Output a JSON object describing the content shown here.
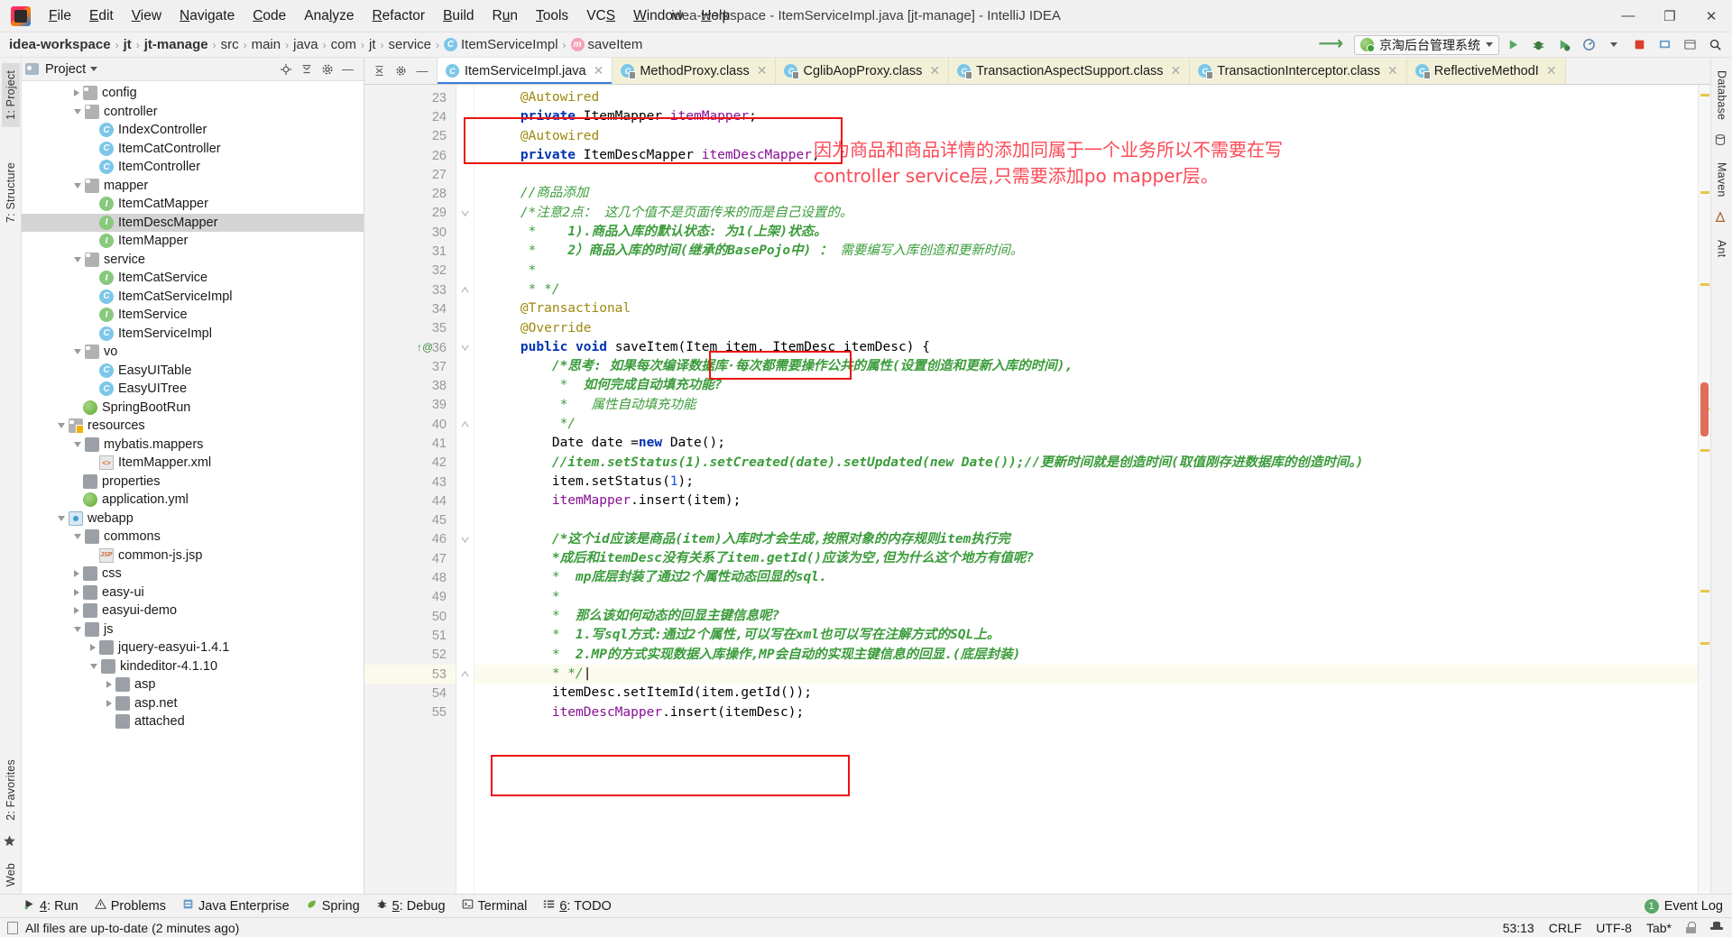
{
  "window": {
    "title": "idea-workspace - ItemServiceImpl.java [jt-manage] - IntelliJ IDEA",
    "minimize": "—",
    "maximize": "❐",
    "close": "✕"
  },
  "menubar": {
    "items": [
      "File",
      "Edit",
      "View",
      "Navigate",
      "Code",
      "Analyze",
      "Refactor",
      "Build",
      "Run",
      "Tools",
      "VCS",
      "Window",
      "Help"
    ]
  },
  "breadcrumb": {
    "items": [
      {
        "label": "idea-workspace",
        "icon": "",
        "strong": true
      },
      {
        "label": "jt",
        "icon": "",
        "strong": true
      },
      {
        "label": "jt-manage",
        "icon": "",
        "strong": true
      },
      {
        "label": "src",
        "icon": "",
        "strong": false
      },
      {
        "label": "main",
        "icon": "",
        "strong": false
      },
      {
        "label": "java",
        "icon": "",
        "strong": false
      },
      {
        "label": "com",
        "icon": "",
        "strong": false
      },
      {
        "label": "jt",
        "icon": "",
        "strong": false
      },
      {
        "label": "service",
        "icon": "",
        "strong": false
      },
      {
        "label": "ItemServiceImpl",
        "icon": "class-icon",
        "strong": false
      },
      {
        "label": "saveItem",
        "icon": "method-icon",
        "strong": false
      }
    ],
    "separator": "›"
  },
  "toolbar": {
    "run_configuration": "京淘后台管理系统",
    "icons": [
      "run-icon",
      "debug-icon",
      "run-with-coverage-icon",
      "profile-icon",
      "attach-icon",
      "stop-icon",
      "update-icon",
      "settings-icon",
      "search-icon"
    ]
  },
  "project_panel": {
    "title": "Project",
    "header_buttons": [
      "locate-icon",
      "collapse-all-icon",
      "settings-icon",
      "hide-icon"
    ],
    "tree": [
      {
        "indent": 3,
        "arrow": "closed",
        "icon": "folder",
        "label": "config",
        "selected": false
      },
      {
        "indent": 3,
        "arrow": "open",
        "icon": "folder",
        "label": "controller",
        "selected": false
      },
      {
        "indent": 4,
        "arrow": "none",
        "icon": "class",
        "label": "IndexController",
        "selected": false
      },
      {
        "indent": 4,
        "arrow": "none",
        "icon": "class",
        "label": "ItemCatController",
        "selected": false
      },
      {
        "indent": 4,
        "arrow": "none",
        "icon": "class",
        "label": "ItemController",
        "selected": false
      },
      {
        "indent": 3,
        "arrow": "open",
        "icon": "folder",
        "label": "mapper",
        "selected": false
      },
      {
        "indent": 4,
        "arrow": "none",
        "icon": "iface",
        "label": "ItemCatMapper",
        "selected": false
      },
      {
        "indent": 4,
        "arrow": "none",
        "icon": "iface",
        "label": "ItemDescMapper",
        "selected": true
      },
      {
        "indent": 4,
        "arrow": "none",
        "icon": "iface",
        "label": "ItemMapper",
        "selected": false
      },
      {
        "indent": 3,
        "arrow": "open",
        "icon": "folder",
        "label": "service",
        "selected": false
      },
      {
        "indent": 4,
        "arrow": "none",
        "icon": "iface",
        "label": "ItemCatService",
        "selected": false
      },
      {
        "indent": 4,
        "arrow": "none",
        "icon": "class",
        "label": "ItemCatServiceImpl",
        "selected": false
      },
      {
        "indent": 4,
        "arrow": "none",
        "icon": "iface",
        "label": "ItemService",
        "selected": false
      },
      {
        "indent": 4,
        "arrow": "none",
        "icon": "class",
        "label": "ItemServiceImpl",
        "selected": false
      },
      {
        "indent": 3,
        "arrow": "open",
        "icon": "folder",
        "label": "vo",
        "selected": false
      },
      {
        "indent": 4,
        "arrow": "none",
        "icon": "class",
        "label": "EasyUITable",
        "selected": false
      },
      {
        "indent": 4,
        "arrow": "none",
        "icon": "class",
        "label": "EasyUITree",
        "selected": false
      },
      {
        "indent": 3,
        "arrow": "none",
        "icon": "spring",
        "label": "SpringBootRun",
        "selected": false
      },
      {
        "indent": 2,
        "arrow": "open",
        "icon": "folder-res",
        "label": "resources",
        "selected": false
      },
      {
        "indent": 3,
        "arrow": "open",
        "icon": "folder-plain",
        "label": "mybatis.mappers",
        "selected": false
      },
      {
        "indent": 4,
        "arrow": "none",
        "icon": "xml",
        "label": "ItemMapper.xml",
        "selected": false
      },
      {
        "indent": 3,
        "arrow": "none",
        "icon": "folder-plain",
        "label": "properties",
        "selected": false
      },
      {
        "indent": 3,
        "arrow": "none",
        "icon": "spring",
        "label": "application.yml",
        "selected": false
      },
      {
        "indent": 2,
        "arrow": "open",
        "icon": "web",
        "label": "webapp",
        "selected": false
      },
      {
        "indent": 3,
        "arrow": "open",
        "icon": "folder-plain",
        "label": "commons",
        "selected": false
      },
      {
        "indent": 4,
        "arrow": "none",
        "icon": "jsp",
        "label": "common-js.jsp",
        "selected": false
      },
      {
        "indent": 3,
        "arrow": "closed",
        "icon": "folder-plain",
        "label": "css",
        "selected": false
      },
      {
        "indent": 3,
        "arrow": "closed",
        "icon": "folder-plain",
        "label": "easy-ui",
        "selected": false
      },
      {
        "indent": 3,
        "arrow": "closed",
        "icon": "folder-plain",
        "label": "easyui-demo",
        "selected": false
      },
      {
        "indent": 3,
        "arrow": "open",
        "icon": "folder-plain",
        "label": "js",
        "selected": false
      },
      {
        "indent": 4,
        "arrow": "closed",
        "icon": "folder-plain",
        "label": "jquery-easyui-1.4.1",
        "selected": false
      },
      {
        "indent": 4,
        "arrow": "open",
        "icon": "folder-plain",
        "label": "kindeditor-4.1.10",
        "selected": false
      },
      {
        "indent": 5,
        "arrow": "closed",
        "icon": "folder-plain",
        "label": "asp",
        "selected": false
      },
      {
        "indent": 5,
        "arrow": "closed",
        "icon": "folder-plain",
        "label": "asp.net",
        "selected": false
      },
      {
        "indent": 5,
        "arrow": "none",
        "icon": "folder-plain",
        "label": "attached",
        "selected": false
      }
    ]
  },
  "left_rail": {
    "tabs": [
      "1: Project",
      "7: Structure",
      "2: Favorites",
      "Web"
    ]
  },
  "right_rail": {
    "tabs": [
      "Database",
      "Maven",
      "Ant"
    ]
  },
  "tabs": [
    {
      "label": "ItemServiceImpl.java",
      "icon": "java-class-icon",
      "active": true,
      "locked": false
    },
    {
      "label": "MethodProxy.class",
      "icon": "class-file-icon",
      "active": false,
      "locked": true
    },
    {
      "label": "CglibAopProxy.class",
      "icon": "class-file-icon",
      "active": false,
      "locked": true
    },
    {
      "label": "TransactionAspectSupport.class",
      "icon": "class-file-icon",
      "active": false,
      "locked": true
    },
    {
      "label": "TransactionInterceptor.class",
      "icon": "class-file-icon",
      "active": false,
      "locked": true
    },
    {
      "label": "ReflectiveMethodI",
      "icon": "class-file-icon",
      "active": false,
      "locked": true
    }
  ],
  "editor": {
    "first_line_number": 23,
    "current_line": 53,
    "lines": [
      {
        "n": 23,
        "fold": "",
        "marks": "",
        "tokens": [
          {
            "t": "    ",
            "c": "pun"
          },
          {
            "t": "@Autowired",
            "c": "ann"
          }
        ]
      },
      {
        "n": 24,
        "fold": "",
        "marks": "",
        "tokens": [
          {
            "t": "    ",
            "c": "pun"
          },
          {
            "t": "private ",
            "c": "kw"
          },
          {
            "t": "ItemMapper ",
            "c": "typ"
          },
          {
            "t": "itemMapper",
            "c": "fld"
          },
          {
            "t": ";",
            "c": "pun"
          }
        ]
      },
      {
        "n": 25,
        "fold": "",
        "marks": "",
        "tokens": [
          {
            "t": "    ",
            "c": "pun"
          },
          {
            "t": "@Autowired",
            "c": "ann"
          }
        ]
      },
      {
        "n": 26,
        "fold": "",
        "marks": "",
        "tokens": [
          {
            "t": "    ",
            "c": "pun"
          },
          {
            "t": "private ",
            "c": "kw"
          },
          {
            "t": "ItemDescMapper ",
            "c": "typ"
          },
          {
            "t": "itemDescMapper",
            "c": "fld"
          },
          {
            "t": ";",
            "c": "pun"
          }
        ]
      },
      {
        "n": 27,
        "fold": "",
        "marks": "",
        "tokens": []
      },
      {
        "n": 28,
        "fold": "",
        "marks": "",
        "tokens": [
          {
            "t": "    ",
            "c": "pun"
          },
          {
            "t": "//商品添加",
            "c": "cmtg"
          }
        ]
      },
      {
        "n": 29,
        "fold": "minus",
        "marks": "",
        "tokens": [
          {
            "t": "    ",
            "c": "pun"
          },
          {
            "t": "/*注意2点： 这几个值不是页面传来的而是自己设置的。",
            "c": "cmtg"
          }
        ]
      },
      {
        "n": 30,
        "fold": "",
        "marks": "",
        "tokens": [
          {
            "t": "     *    ",
            "c": "cmtg"
          },
          {
            "t": "1).商品入库的默认状态: 为1(上架)状态。",
            "c": "cmtgb"
          }
        ]
      },
      {
        "n": 31,
        "fold": "",
        "marks": "",
        "tokens": [
          {
            "t": "     *    ",
            "c": "cmtg"
          },
          {
            "t": "2）商品入库的时间(继承的BasePojo中) ： ",
            "c": "cmtgb"
          },
          {
            "t": "需要编写入库创造和更新时间。",
            "c": "cmtg"
          }
        ]
      },
      {
        "n": 32,
        "fold": "",
        "marks": "",
        "tokens": [
          {
            "t": "     *",
            "c": "cmtg"
          }
        ]
      },
      {
        "n": 33,
        "fold": "plus",
        "marks": "",
        "tokens": [
          {
            "t": "     * */",
            "c": "cmtg"
          }
        ]
      },
      {
        "n": 34,
        "fold": "",
        "marks": "",
        "tokens": [
          {
            "t": "    ",
            "c": "pun"
          },
          {
            "t": "@Transactional",
            "c": "ann"
          }
        ]
      },
      {
        "n": 35,
        "fold": "",
        "marks": "",
        "tokens": [
          {
            "t": "    ",
            "c": "pun"
          },
          {
            "t": "@Override",
            "c": "ann"
          }
        ]
      },
      {
        "n": 36,
        "fold": "minus",
        "marks": "impl",
        "tokens": [
          {
            "t": "    ",
            "c": "pun"
          },
          {
            "t": "public ",
            "c": "kw"
          },
          {
            "t": "void ",
            "c": "kw"
          },
          {
            "t": "saveItem",
            "c": "typ"
          },
          {
            "t": "(",
            "c": "pun"
          },
          {
            "t": "Item ",
            "c": "typ"
          },
          {
            "t": "item",
            "c": "pun"
          },
          {
            "t": ", ",
            "c": "pun"
          },
          {
            "t": "ItemDesc ",
            "c": "typ"
          },
          {
            "t": "itemDesc",
            "c": "pun"
          },
          {
            "t": ") {",
            "c": "pun"
          }
        ]
      },
      {
        "n": 37,
        "fold": "",
        "marks": "",
        "tokens": [
          {
            "t": "        ",
            "c": "pun"
          },
          {
            "t": "/*思考: 如果每次编译数据库·每次都需要操作公共的属性(设置创造和更新入库的时间),",
            "c": "cmtgb"
          }
        ]
      },
      {
        "n": 38,
        "fold": "",
        "marks": "",
        "tokens": [
          {
            "t": "         *  ",
            "c": "cmtg"
          },
          {
            "t": "如何完成自动填充功能?",
            "c": "cmtgb"
          }
        ]
      },
      {
        "n": 39,
        "fold": "",
        "marks": "",
        "tokens": [
          {
            "t": "         *   ",
            "c": "cmtg"
          },
          {
            "t": "属性自动填充功能",
            "c": "cmtg"
          }
        ]
      },
      {
        "n": 40,
        "fold": "plus",
        "marks": "",
        "tokens": [
          {
            "t": "         */",
            "c": "cmtg"
          }
        ]
      },
      {
        "n": 41,
        "fold": "",
        "marks": "",
        "tokens": [
          {
            "t": "        ",
            "c": "pun"
          },
          {
            "t": "Date ",
            "c": "typ"
          },
          {
            "t": "date ",
            "c": "pun"
          },
          {
            "t": "=",
            "c": "pun"
          },
          {
            "t": "new ",
            "c": "kw"
          },
          {
            "t": "Date",
            "c": "typ"
          },
          {
            "t": "();",
            "c": "pun"
          }
        ]
      },
      {
        "n": 42,
        "fold": "",
        "marks": "",
        "tokens": [
          {
            "t": "        ",
            "c": "pun"
          },
          {
            "t": "//item.setStatus(1).setCreated(date).setUpdated(new Date());//更新时间就是创造时间(取值刚存进数据库的创造时间。)",
            "c": "cmtgb"
          }
        ]
      },
      {
        "n": 43,
        "fold": "",
        "marks": "",
        "tokens": [
          {
            "t": "        ",
            "c": "pun"
          },
          {
            "t": "item",
            "c": "pun"
          },
          {
            "t": ".setStatus(",
            "c": "pun"
          },
          {
            "t": "1",
            "c": "num"
          },
          {
            "t": ");",
            "c": "pun"
          }
        ]
      },
      {
        "n": 44,
        "fold": "",
        "marks": "",
        "tokens": [
          {
            "t": "        ",
            "c": "pun"
          },
          {
            "t": "itemMapper",
            "c": "fld"
          },
          {
            "t": ".insert(item);",
            "c": "pun"
          }
        ]
      },
      {
        "n": 45,
        "fold": "",
        "marks": "",
        "tokens": []
      },
      {
        "n": 46,
        "fold": "minus",
        "marks": "",
        "tokens": [
          {
            "t": "        ",
            "c": "pun"
          },
          {
            "t": "/*这个id应该是商品(item)入库时才会生成,按照对象的内存规则item执行完",
            "c": "cmtgb"
          }
        ]
      },
      {
        "n": 47,
        "fold": "",
        "marks": "",
        "tokens": [
          {
            "t": "        *成后和itemDesc没有关系了item.getId()应该为空,但为什么这个地方有值呢?",
            "c": "cmtgb"
          }
        ]
      },
      {
        "n": 48,
        "fold": "",
        "marks": "",
        "tokens": [
          {
            "t": "        *  ",
            "c": "cmtg"
          },
          {
            "t": "mp底层封装了通过2个属性动态回显的sql.",
            "c": "cmtgb"
          }
        ]
      },
      {
        "n": 49,
        "fold": "",
        "marks": "",
        "tokens": [
          {
            "t": "        *",
            "c": "cmtg"
          }
        ]
      },
      {
        "n": 50,
        "fold": "",
        "marks": "",
        "tokens": [
          {
            "t": "        *  ",
            "c": "cmtg"
          },
          {
            "t": "那么该如何动态的回显主键信息呢?",
            "c": "cmtgb"
          }
        ]
      },
      {
        "n": 51,
        "fold": "",
        "marks": "",
        "tokens": [
          {
            "t": "        *  ",
            "c": "cmtg"
          },
          {
            "t": "1.写sql方式:通过2个属性,可以写在xml也可以写在注解方式的SQL上。",
            "c": "cmtgb"
          }
        ]
      },
      {
        "n": 52,
        "fold": "",
        "marks": "",
        "tokens": [
          {
            "t": "        *  ",
            "c": "cmtg"
          },
          {
            "t": "2.MP的方式实现数据入库操作,MP会自动的实现主键信息的回显.(底层封装)",
            "c": "cmtgb"
          }
        ]
      },
      {
        "n": 53,
        "fold": "plus",
        "marks": "",
        "tokens": [
          {
            "t": "        * */",
            "c": "cmtg"
          }
        ]
      },
      {
        "n": 54,
        "fold": "",
        "marks": "",
        "tokens": [
          {
            "t": "        ",
            "c": "pun"
          },
          {
            "t": "itemDesc",
            "c": "pun"
          },
          {
            "t": ".setItemId(item.getId());",
            "c": "pun"
          }
        ]
      },
      {
        "n": 55,
        "fold": "",
        "marks": "",
        "tokens": [
          {
            "t": "        ",
            "c": "pun"
          },
          {
            "t": "itemDescMapper",
            "c": "fld"
          },
          {
            "t": ".insert(itemDesc);",
            "c": "pun"
          }
        ]
      }
    ],
    "annotation_text": "因为商品和商品详情的添加同属于一个业务所以不需要在写\ncontroller service层,只需要添加po mapper层。",
    "annotation_color": "#fb4a56"
  },
  "bottom_toolwindows": [
    {
      "icon": "run-icon",
      "num": "4",
      "label": ": Run"
    },
    {
      "icon": "warning-icon",
      "num": "",
      "label": "Problems"
    },
    {
      "icon": "java-enterprise-icon",
      "num": "",
      "label": "Java Enterprise"
    },
    {
      "icon": "spring-leaf-icon",
      "num": "",
      "label": "Spring"
    },
    {
      "icon": "debug-bug-icon",
      "num": "5",
      "label": ": Debug"
    },
    {
      "icon": "terminal-icon",
      "num": "",
      "label": "Terminal"
    },
    {
      "icon": "todo-icon",
      "num": "6",
      "label": ": TODO"
    }
  ],
  "event_log": {
    "count": "1",
    "label": "Event Log"
  },
  "statusbar": {
    "message": "All files are up-to-date (2 minutes ago)",
    "caret": "53:13",
    "line_separator": "CRLF",
    "encoding": "UTF-8",
    "indent": "Tab*",
    "icons": [
      "lock-icon",
      "hector-icon"
    ]
  }
}
